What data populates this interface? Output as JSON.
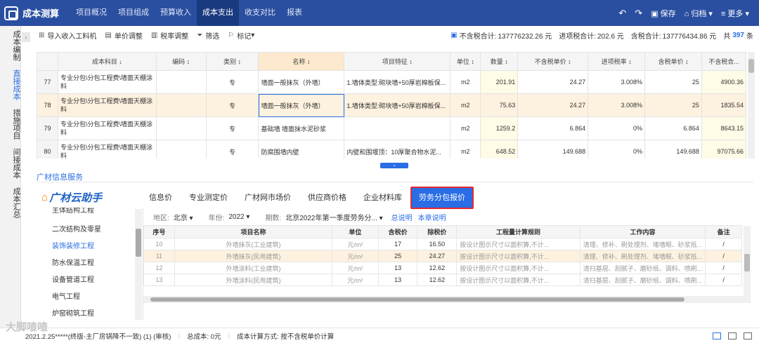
{
  "app": {
    "title": "成本测算"
  },
  "nav": [
    "项目概况",
    "项目组成",
    "预算收入",
    "成本支出",
    "收支对比",
    "报表"
  ],
  "nav_active": 3,
  "top_actions": {
    "save": "保存",
    "archive": "归档",
    "more": "更多"
  },
  "sidebar": [
    "成本编制",
    "直接成本",
    "措施项目",
    "间接成本",
    "成本汇总"
  ],
  "sidebar_active": 1,
  "toolbar": [
    "导入收入工料机",
    "单价调整",
    "税率调整",
    "筛选",
    "标记"
  ],
  "summary": {
    "pre_tax_label": "不含税合计:",
    "pre_tax": "137776232.26 元",
    "tax_rate_label": "进项税合计:",
    "tax_rate": "202.6 元",
    "tax_total_label": "含税合计:",
    "tax_total": "137776434.86 元",
    "count_prefix": "共",
    "count": "397",
    "count_suffix": "条"
  },
  "table1": {
    "headers": [
      "成本科目 ↓",
      "编码 ↕",
      "类别 ↕",
      "名称 ↕",
      "项目特征 ↕",
      "单位 ↕",
      "数量 ↕",
      "不含税单价 ↕",
      "进项税率 ↕",
      "含税单价 ↕",
      "不含税合..."
    ],
    "rows": [
      {
        "no": "77",
        "subject": "专业分包\\分包工程费\\墙面天棚涂料",
        "code": "",
        "type": "专",
        "name": "墙面一般抹灰（外墙）",
        "feature": "1.墙体类型:砌块墙+50厚岩棉板保...",
        "unit": "m2",
        "qty": "201.91",
        "price": "24.27",
        "rate": "3.008%",
        "tax_price": "25",
        "total": "4900.36"
      },
      {
        "no": "78",
        "subject": "专业分包\\分包工程费\\墙面天棚涂料",
        "code": "",
        "type": "专",
        "name": "墙面一般抹灰（外墙）",
        "feature": "1.墙体类型:砌块墙+50厚岩棉板保...",
        "unit": "m2",
        "qty": "75.63",
        "price": "24.27",
        "rate": "3.008%",
        "tax_price": "25",
        "total": "1835.54"
      },
      {
        "no": "79",
        "subject": "专业分包\\分包工程费\\墙面天棚涂料",
        "code": "",
        "type": "专",
        "name": "基础墙 墙面抹水泥砂浆",
        "feature": "",
        "unit": "m2",
        "qty": "1259.2",
        "price": "6.864",
        "rate": "0%",
        "tax_price": "6.864",
        "total": "8643.15"
      },
      {
        "no": "80",
        "subject": "专业分包\\分包工程费\\墙面天棚涂料",
        "code": "",
        "type": "专",
        "name": "防腐围墙内壁",
        "feature": "内壁和围堰顶：10厚聚合物水泥...",
        "unit": "m2",
        "qty": "648.52",
        "price": "149.688",
        "rate": "0%",
        "tax_price": "149.688",
        "total": "97075.66"
      }
    ]
  },
  "section_title": "广材信息服务",
  "brand": "广材云助手",
  "tabs": [
    "信息价",
    "专业测定价",
    "广材网市场价",
    "供应商价格",
    "企业材料库",
    "劳务分包报价"
  ],
  "tabs_active": 5,
  "left_list": [
    "主体结构工程",
    "二次结构及零星",
    "装饰装修工程",
    "防水保温工程",
    "设备管道工程",
    "电气工程",
    "炉窑砌筑工程"
  ],
  "left_active": 2,
  "filter": {
    "area_label": "地区:",
    "area": "北京",
    "year_label": "年份:",
    "year": "2022",
    "period_label": "期数:",
    "period": "北京2022年第一季度劳务分...",
    "link1": "总说明",
    "link2": "本章说明"
  },
  "table2": {
    "headers": [
      "序号",
      "项目名称",
      "单位",
      "含税价",
      "除税价",
      "工程量计算规则",
      "工作内容",
      "备注"
    ],
    "rows": [
      {
        "no": "10",
        "name": "外墙抹灰(工业建筑)",
        "unit": "元/m²",
        "tax": "17",
        "notax": "16.50",
        "rule": "按设计图示尺寸以面积算,不计...",
        "work": "清理、修补、刷处理剂、堵墙眼、砂浆抵...",
        "remark": "/"
      },
      {
        "no": "11",
        "name": "外墙抹灰(民用建筑)",
        "unit": "元/m²",
        "tax": "25",
        "notax": "24.27",
        "rule": "按设计图示尺寸以面积算,不计...",
        "work": "清理、修补、刷处理剂、堵墙眼、砂浆抵...",
        "remark": "/"
      },
      {
        "no": "12",
        "name": "外墙涂料(工业建筑)",
        "unit": "元/m²",
        "tax": "13",
        "notax": "12.62",
        "rule": "按设计图示尺寸以面积算,不计...",
        "work": "清扫基层、刮腻子、磨砂纸、调料、喷刷...",
        "remark": "/"
      },
      {
        "no": "13",
        "name": "外墙涂料(民用建筑)",
        "unit": "元/m²",
        "tax": "13",
        "notax": "12.62",
        "rule": "按设计图示尺寸以面积算,不计...",
        "work": "清扫基层、刮腻子、磨砂纸、调料、喷刷...",
        "remark": "/"
      }
    ]
  },
  "status": {
    "project": "2021.2.25*****(终版-主厂房锅降不一致) (1) (审核)",
    "cost": "总成本: 0元",
    "method": "成本计算方式: 按不含税单价计算",
    "watermark": "大脚喳喳"
  }
}
